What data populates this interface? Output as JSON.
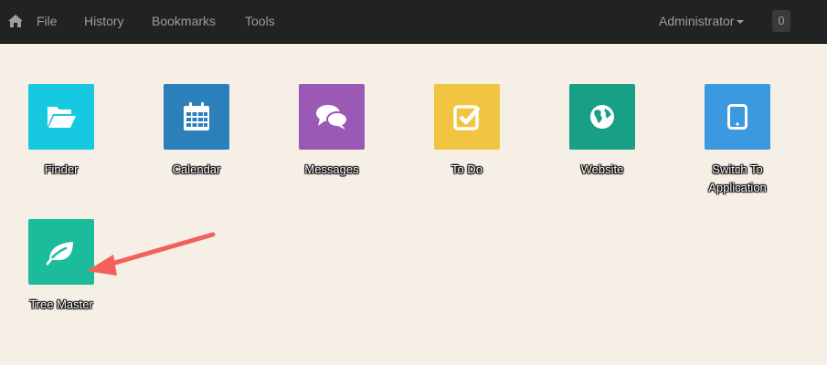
{
  "navbar": {
    "home_icon": "home-icon",
    "menu": [
      "File",
      "History",
      "Bookmarks",
      "Tools"
    ],
    "user": "Administrator",
    "badge": "0"
  },
  "apps": [
    {
      "label": "Finder",
      "icon": "folder-open-icon",
      "color": "#17c9e0"
    },
    {
      "label": "Calendar",
      "icon": "calendar-icon",
      "color": "#2b7fba"
    },
    {
      "label": "Messages",
      "icon": "comments-icon",
      "color": "#9b59b6"
    },
    {
      "label": "To Do",
      "icon": "check-square-icon",
      "color": "#f1c542"
    },
    {
      "label": "Website",
      "icon": "globe-icon",
      "color": "#17a086"
    },
    {
      "label": "Switch To Application",
      "icon": "tablet-icon",
      "color": "#3b99e0"
    },
    {
      "label": "Tree Master",
      "icon": "leaf-icon",
      "color": "#1abc9c"
    }
  ],
  "annotation": {
    "color": "#f2615b"
  }
}
